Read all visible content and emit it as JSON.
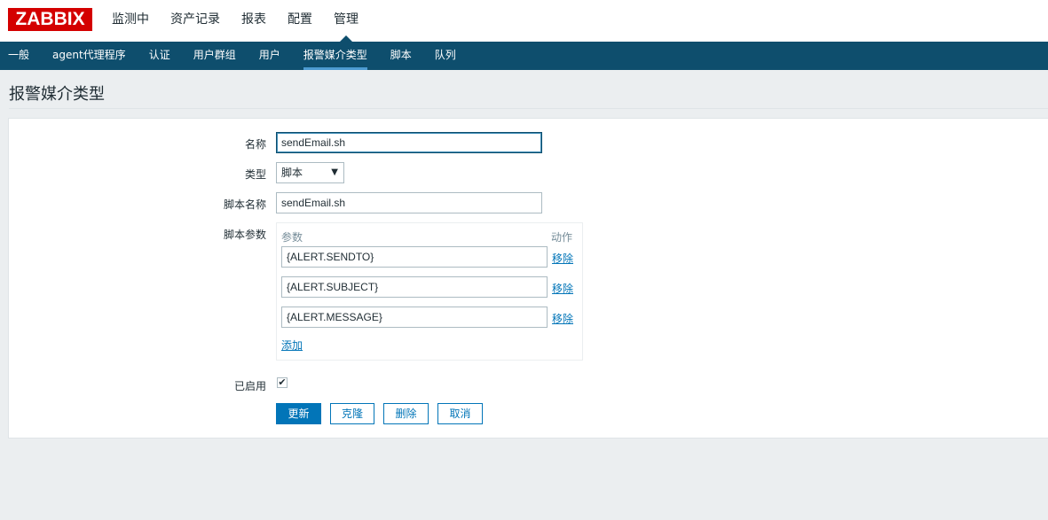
{
  "logo": "ZABBIX",
  "main_nav": [
    "监测中",
    "资产记录",
    "报表",
    "配置",
    "管理"
  ],
  "sub_nav": [
    "一般",
    "agent代理程序",
    "认证",
    "用户群组",
    "用户",
    "报警媒介类型",
    "脚本",
    "队列"
  ],
  "page_title": "报警媒介类型",
  "form": {
    "name_label": "名称",
    "name_value": "sendEmail.sh",
    "type_label": "类型",
    "type_value": "脚本",
    "script_name_label": "脚本名称",
    "script_name_value": "sendEmail.sh",
    "script_params_label": "脚本参数",
    "params_header_param": "参数",
    "params_header_action": "动作",
    "params": [
      "{ALERT.SENDTO}",
      "{ALERT.SUBJECT}",
      "{ALERT.MESSAGE}"
    ],
    "remove_label": "移除",
    "add_label": "添加",
    "enabled_label": "已启用",
    "enabled": true
  },
  "buttons": {
    "update": "更新",
    "clone": "克隆",
    "delete": "删除",
    "cancel": "取消"
  },
  "colors": {
    "brand": "#d40000",
    "subnav_bg": "#0e4e6d",
    "primary": "#0275b8"
  }
}
